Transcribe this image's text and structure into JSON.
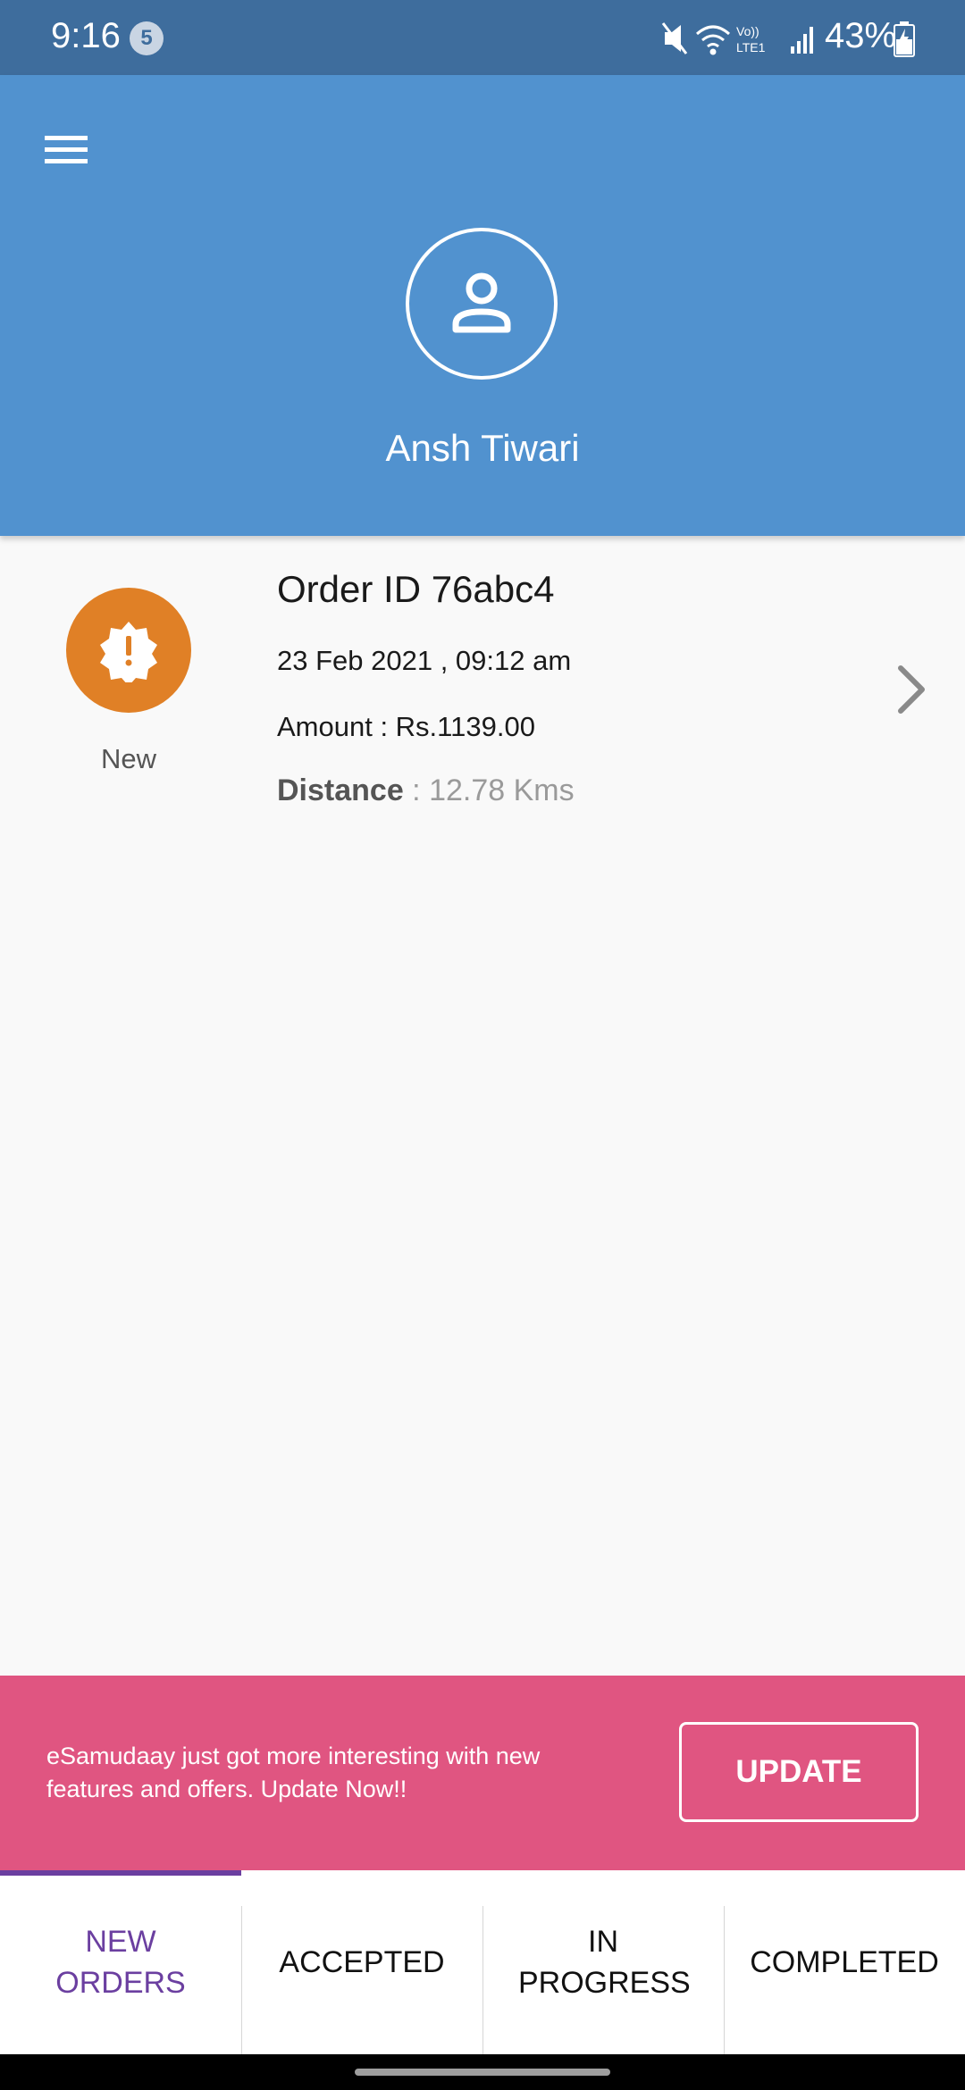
{
  "status_bar": {
    "time": "9:16",
    "notification_count": "5",
    "network_label": "Vo)) LTE1",
    "battery": "43%"
  },
  "header": {
    "user_name": "Ansh Tiwari",
    "bg_color": "#5192cf"
  },
  "order": {
    "status_label": "New",
    "status_color": "#e08026",
    "id_text": "Order ID 76abc4",
    "date_text": "23 Feb 2021 , 09:12 am",
    "amount_text": "Amount : Rs.1139.00",
    "distance_label": "Distance",
    "distance_sep": " : ",
    "distance_value": "12.78 Kms"
  },
  "update_banner": {
    "message": "eSamudaay just got more interesting with new features and offers. Update Now!!",
    "button_label": "UPDATE",
    "bg_color": "#e05581"
  },
  "tabs": [
    {
      "label": "NEW ORDERS",
      "active": true
    },
    {
      "label": "ACCEPTED",
      "active": false
    },
    {
      "label": "IN PROGRESS",
      "active": false
    },
    {
      "label": "COMPLETED",
      "active": false
    }
  ],
  "icons": {
    "menu": "hamburger-menu-icon",
    "avatar": "person-icon",
    "order_status": "alert-badge-icon",
    "chevron": "chevron-right-icon"
  }
}
